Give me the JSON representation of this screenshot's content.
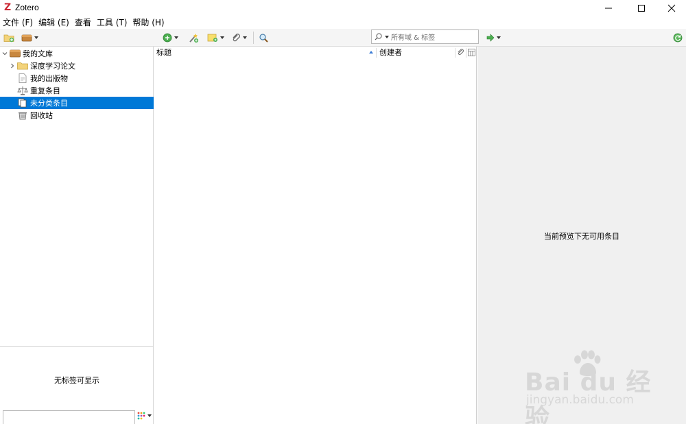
{
  "window": {
    "logo": "Z",
    "title": "Zotero"
  },
  "menu": [
    {
      "label": "文件 (F)"
    },
    {
      "label": "编辑 (E)"
    },
    {
      "label": "查看"
    },
    {
      "label": "工具 (T)"
    },
    {
      "label": "帮助 (H)"
    }
  ],
  "toolbar": {
    "search_placeholder": "所有域 & 标签"
  },
  "collections": {
    "root": {
      "label": "我的文库",
      "expanded": true
    },
    "items": [
      {
        "label": "深度学习论文",
        "icon": "folder-icon",
        "has_children": true
      },
      {
        "label": "我的出版物",
        "icon": "publications-icon"
      },
      {
        "label": "重复条目",
        "icon": "duplicates-icon"
      },
      {
        "label": "未分类条目",
        "icon": "unfiled-icon",
        "selected": true
      },
      {
        "label": "回收站",
        "icon": "trash-icon"
      }
    ]
  },
  "tags": {
    "empty_message": "无标签可显示",
    "filter_value": ""
  },
  "items_table": {
    "columns": [
      {
        "label": "标题",
        "sorted": "ascending"
      },
      {
        "label": "创建者"
      }
    ],
    "rows": []
  },
  "item_pane": {
    "message": "当前预览下无可用条目"
  },
  "watermark": {
    "brand": "Bai du 经验",
    "url": "jingyan.baidu.com"
  },
  "colors": {
    "selection": "#0078d7",
    "logo_red": "#cc2936",
    "item_pane_bg": "#f0f0f0",
    "toolbar_bg": "#f5f5f5"
  }
}
